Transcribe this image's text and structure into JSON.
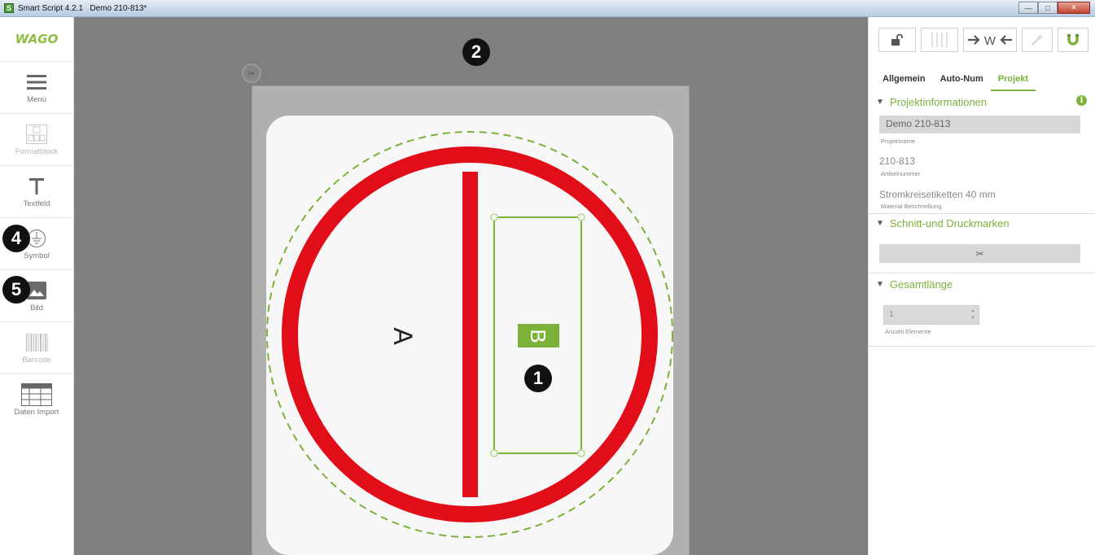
{
  "window": {
    "app_icon": "S",
    "title": "Smart Script 4.2.1   Demo 210-813*",
    "buttons": [
      "minimize",
      "maximize",
      "close"
    ]
  },
  "left_toolbar": {
    "logo": "WAGO",
    "tools": [
      {
        "label": "Menü",
        "icon": "hamburger-icon",
        "enabled": true
      },
      {
        "label": "Formatblock",
        "icon": "grid-block-icon",
        "enabled": false
      },
      {
        "label": "Textfeld",
        "icon": "text-t-icon",
        "enabled": true
      },
      {
        "label": "Symbol",
        "icon": "ground-symbol-icon",
        "enabled": true
      },
      {
        "label": "Bild",
        "icon": "image-icon",
        "enabled": true
      },
      {
        "label": "Barcode",
        "icon": "barcode-icon",
        "enabled": false
      },
      {
        "label": "Daten Import",
        "icon": "table-import-icon",
        "enabled": true
      }
    ]
  },
  "canvas": {
    "text_a": "A",
    "text_b": "B",
    "colors": {
      "workspace": "#7f7f7d",
      "paper": "#b0b0b0",
      "ring": "#e10e1a",
      "selection": "#7cb13a"
    }
  },
  "callouts": {
    "c1": "1",
    "c2": "2",
    "c4": "4",
    "c5": "5"
  },
  "right_panel": {
    "toolbar": [
      "lock-icon",
      "columns-icon",
      "fit-width-icon",
      "magic-wand-icon",
      "magnet-icon"
    ],
    "fit_width_label": "W",
    "tabs": [
      {
        "label": "Allgemein",
        "active": false
      },
      {
        "label": "Auto-Num",
        "active": false
      },
      {
        "label": "Projekt",
        "active": true
      }
    ],
    "project_info": {
      "heading": "Projektinformationen",
      "project_name": "Demo 210-813",
      "project_name_label": "Projektname",
      "article_number": "210-813",
      "article_number_label": "Artikelnummer",
      "material": "Stromkreisetiketten 40 mm",
      "material_label": "Material Beschreibung"
    },
    "cut_marks": {
      "heading": "Schnitt-und Druckmarken"
    },
    "total_length": {
      "heading": "Gesamtlänge",
      "count_value": "1",
      "count_label": "Anzahl Elemente"
    }
  }
}
